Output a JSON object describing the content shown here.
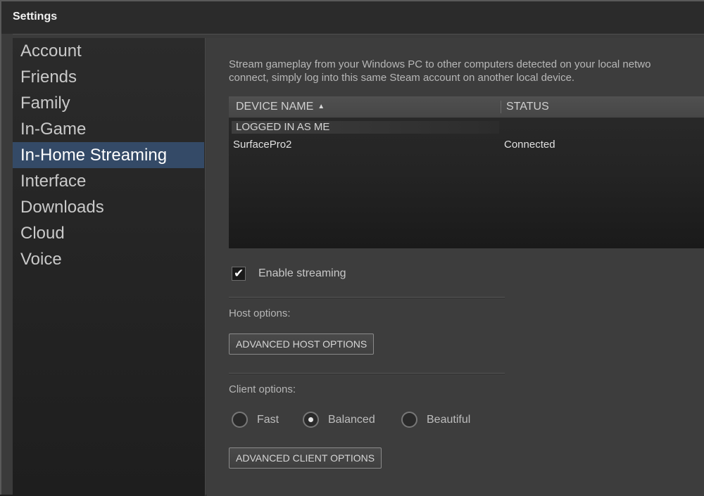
{
  "window": {
    "title": "Settings"
  },
  "sidebar": {
    "items": [
      {
        "label": "Account"
      },
      {
        "label": "Friends"
      },
      {
        "label": "Family"
      },
      {
        "label": "In-Game"
      },
      {
        "label": "In-Home Streaming",
        "active": true
      },
      {
        "label": "Interface"
      },
      {
        "label": "Downloads"
      },
      {
        "label": "Cloud"
      },
      {
        "label": "Voice"
      }
    ]
  },
  "main": {
    "description_line1": "Stream gameplay from your Windows PC to other computers detected on your local netwo",
    "description_line2": "connect, simply log into this same Steam account on another local device.",
    "table": {
      "columns": [
        "DEVICE NAME",
        "STATUS"
      ],
      "sort_indicator": "▲",
      "group_label": "LOGGED IN AS ME",
      "rows": [
        {
          "name": "SurfacePro2",
          "status": "Connected"
        }
      ]
    },
    "enable_streaming": {
      "label": "Enable streaming",
      "checked": true,
      "check_glyph": "✔"
    },
    "host_options": {
      "label": "Host options:",
      "button": "ADVANCED HOST OPTIONS"
    },
    "client_options": {
      "label": "Client options:",
      "radios": [
        {
          "label": "Fast",
          "selected": false
        },
        {
          "label": "Balanced",
          "selected": true
        },
        {
          "label": "Beautiful",
          "selected": false
        }
      ],
      "button": "ADVANCED CLIENT OPTIONS"
    }
  },
  "colors": {
    "active_nav": "#344a67",
    "background": "#3d3d3d"
  }
}
